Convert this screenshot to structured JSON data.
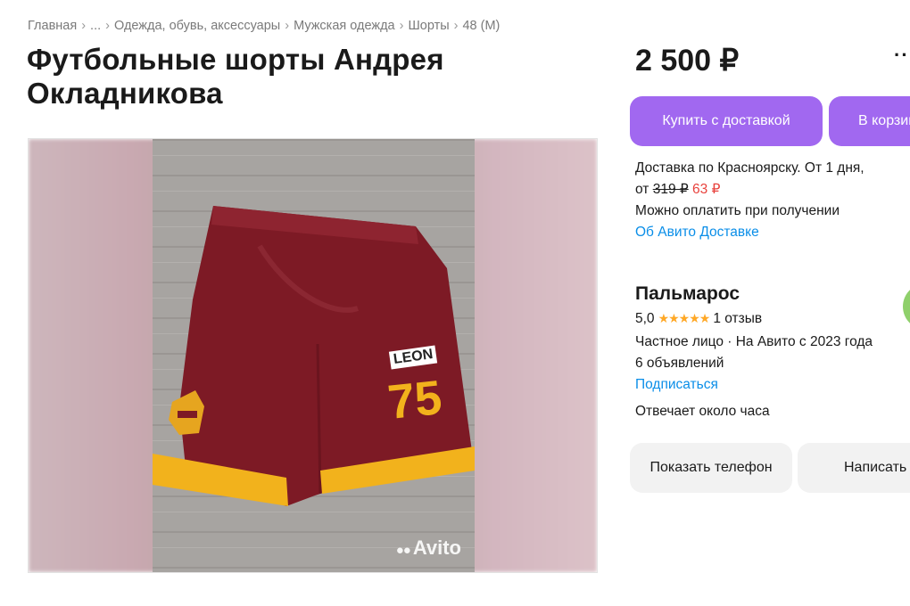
{
  "breadcrumb": {
    "items": [
      "Главная",
      "...",
      "Одежда, обувь, аксессуары",
      "Мужская одежда",
      "Шорты",
      "48 (M)"
    ]
  },
  "title": "Футбольные шорты Андрея Окладникова",
  "gallery": {
    "watermark": "Avito",
    "shorts_print": "LEON",
    "shorts_number": "75",
    "colors": {
      "shorts": "#7d1a25",
      "trim": "#f2b21c"
    }
  },
  "price": "2 500 ₽",
  "actions": {
    "buy_label": "Купить с доставкой",
    "cart_label": "В корзину",
    "more_icon": "more-horizontal-icon"
  },
  "delivery": {
    "line1": "Доставка по Красноярску. От 1 дня,",
    "price_prefix": "от",
    "old_price": "319 ₽",
    "new_price": "63 ₽",
    "cod": "Можно оплатить при получении",
    "about_link": "Об Авито Доставке"
  },
  "seller": {
    "name": "Пальмарос",
    "rating": "5,0",
    "stars": 5,
    "reviews": "1 отзыв",
    "type": "Частное лицо · На Авито с 2023 года",
    "listings": "6 объявлений",
    "subscribe": "Подписаться",
    "response": "Отвечает около часа"
  },
  "contact": {
    "phone_label": "Показать телефон",
    "write_label": "Написать"
  },
  "colors": {
    "accent": "#a168f0",
    "link": "#0a8ee8",
    "sale": "#e8423d",
    "star": "#ffa826"
  }
}
